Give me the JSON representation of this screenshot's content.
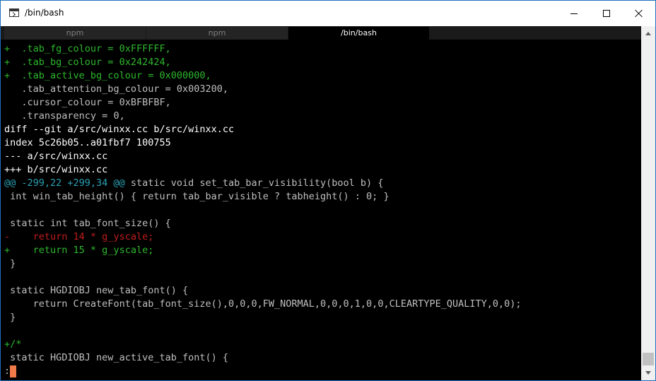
{
  "window": {
    "title": "/bin/bash"
  },
  "tabs": [
    {
      "label": "npm"
    },
    {
      "label": "npm"
    },
    {
      "label": "/bin/bash"
    }
  ],
  "colors": {
    "added": "#2eb82e",
    "removed": "#c21d1d",
    "hunk": "#2aa1b3",
    "text": "#bfbfbf",
    "cursor": "#f07a4a"
  },
  "terminal": {
    "lines": [
      {
        "prefix": "+",
        "text": "  .tab_fg_colour = 0xFFFFFF,"
      },
      {
        "prefix": "+",
        "text": "  .tab_bg_colour = 0x242424,"
      },
      {
        "prefix": "+",
        "text": "  .tab_active_bg_colour = 0x000000,"
      },
      {
        "prefix": " ",
        "text": "  .tab_attention_bg_colour = 0x003200,"
      },
      {
        "prefix": " ",
        "text": "  .cursor_colour = 0xBFBFBF,"
      },
      {
        "prefix": " ",
        "text": "  .transparency = 0,"
      },
      {
        "text": "diff --git a/src/winxx.cc b/src/winxx.cc"
      },
      {
        "text": "index 5c26b05..a01fbf7 100755"
      },
      {
        "text": "--- a/src/winxx.cc"
      },
      {
        "text": "+++ b/src/winxx.cc"
      },
      {
        "hunk": "@@ -299,22 +299,34 @@",
        "text": " static void set_tab_bar_visibility(bool b) {"
      },
      {
        "prefix": " ",
        "text": "int win_tab_height() { return tab_bar_visible ? tabheight() : 0; }"
      },
      {
        "prefix": " ",
        "text": ""
      },
      {
        "prefix": " ",
        "text": "static int tab_font_size() {"
      },
      {
        "prefix": "-",
        "text": "    return 14 * g_yscale;"
      },
      {
        "prefix": "+",
        "text": "    return 15 * g_yscale;"
      },
      {
        "prefix": " ",
        "text": "}"
      },
      {
        "prefix": " ",
        "text": ""
      },
      {
        "prefix": " ",
        "text": "static HGDIOBJ new_tab_font() {"
      },
      {
        "prefix": " ",
        "text": "    return CreateFont(tab_font_size(),0,0,0,FW_NORMAL,0,0,0,1,0,0,CLEARTYPE_QUALITY,0,0);"
      },
      {
        "prefix": " ",
        "text": "}"
      },
      {
        "prefix": " ",
        "text": ""
      },
      {
        "prefix": "+",
        "text": "/*"
      },
      {
        "prefix": " ",
        "text": "static HGDIOBJ new_active_tab_font() {"
      }
    ],
    "prompt": ":"
  }
}
